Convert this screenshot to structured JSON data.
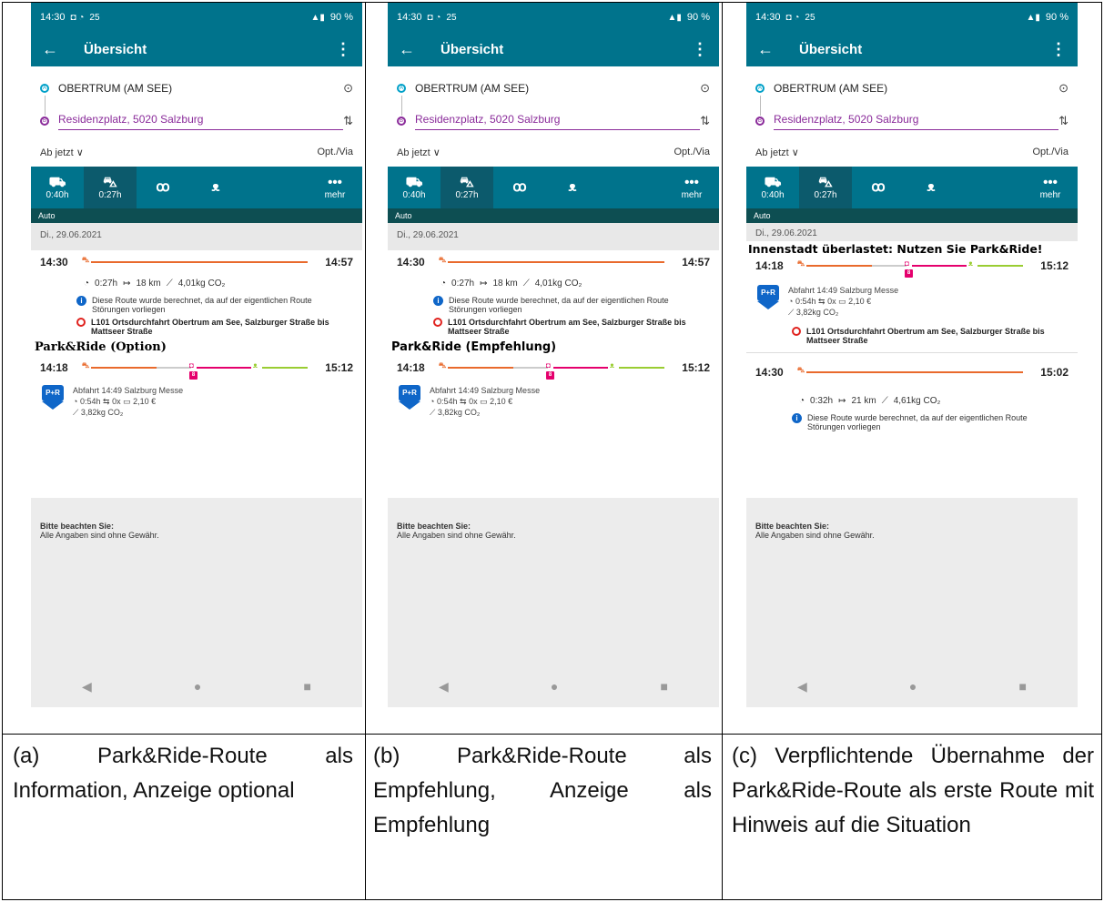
{
  "status": {
    "time": "14:30",
    "battery": "90 %",
    "extra": "25"
  },
  "appbar": {
    "title": "Übersicht",
    "back": "←",
    "menu": "⋮"
  },
  "places": {
    "origin": "OBERTRUM (AM SEE)",
    "destination": "Residenzplatz, 5020 Salzburg",
    "origin_dot": "A",
    "dest_dot": "B"
  },
  "depart": {
    "prefix": "Ab",
    "value": "jetzt",
    "chevron": "∨",
    "options": "Opt./Via"
  },
  "modes": [
    {
      "icon": "bus-icon",
      "glyph": "🚌",
      "time": "0:40h"
    },
    {
      "icon": "car-icon",
      "glyph": "🚗",
      "time": "0:27h"
    },
    {
      "icon": "bike-icon",
      "glyph": "🚲",
      "time": ""
    },
    {
      "icon": "walk-icon",
      "glyph": "🚶",
      "time": ""
    },
    {
      "icon": "more-icon",
      "glyph": "•••",
      "time": "mehr"
    }
  ],
  "auto_label": "Auto",
  "date": "Di., 29.06.2021",
  "car_route": {
    "start": "14:30",
    "end": "14:57",
    "duration": "0:27h",
    "distance": "18 km",
    "co2": "4,01kg CO₂",
    "info": "Diese Route wurde berechnet, da auf der eigentlichen Route Störungen vorliegen",
    "closure": "L101 Ortsdurchfahrt Obertrum am See, Salzburger Straße bis Mattseer Straße"
  },
  "car_route_c": {
    "start": "14:30",
    "end": "15:02",
    "duration": "0:32h",
    "distance": "21 km",
    "co2": "4,61kg CO₂",
    "info": "Diese Route wurde berechnet, da auf der eigentlichen Route Störungen vorliegen"
  },
  "pr_route": {
    "start": "14:18",
    "end": "15:12",
    "badge": "P+R",
    "departure": "Abfahrt 14:49 Salzburg Messe",
    "duration": "0:54h",
    "changes": "0x",
    "price": "2,10 €",
    "co2": "3,82kg CO₂"
  },
  "notes": {
    "title": "Bitte beachten Sie:",
    "text": "Alle Angaben sind ohne Gewähr."
  },
  "overlays": {
    "a": "Park&Ride (Option)",
    "b": "Park&Ride (Empfehlung)",
    "c": "Innenstadt überlastet: Nutzen Sie Park&Ride!"
  },
  "captions": {
    "a": "(a) Park&Ride-Route als Information, Anzeige optional",
    "b": "(b) Park&Ride-Route als Empfehlung, Anzeige als Empfehlung",
    "c": "(c) Verpflichtende Übernahme der Park&Ride-Route als erste Route mit Hinweis auf die Situation"
  },
  "nav": {
    "back": "◀",
    "home": "●",
    "recent": "■"
  },
  "colors": {
    "primary": "#00738c",
    "tab_active": "#0c5a6c",
    "auto_bar": "#0d4e52",
    "car": "#e96a2c",
    "transit": "#e5006d",
    "walk": "#9acd32",
    "destination": "#8a2b9a"
  }
}
